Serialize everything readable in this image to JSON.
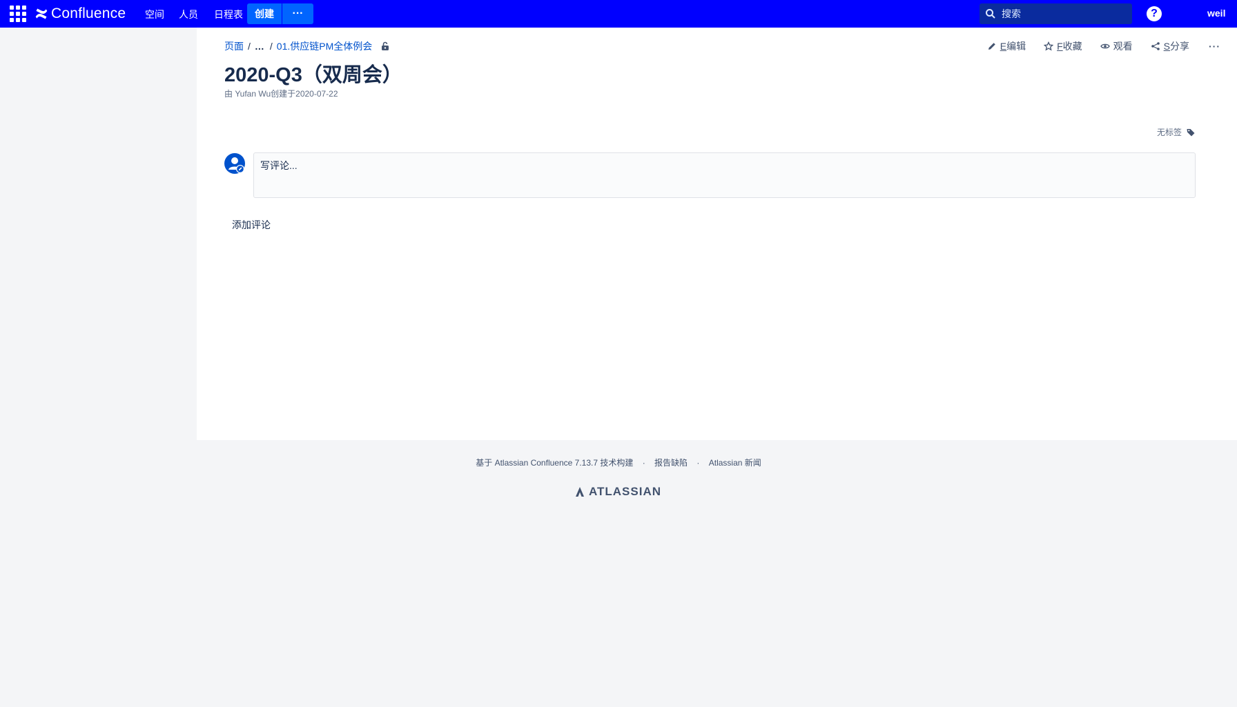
{
  "header": {
    "logo_text": "Confluence",
    "nav": [
      "空间",
      "人员",
      "日程表"
    ],
    "create_label": "创建",
    "more_label": "···",
    "search_placeholder": "搜索",
    "help_label": "?",
    "user": "weil"
  },
  "breadcrumb": {
    "root": "页面",
    "ellipsis": "…",
    "parent": "01.供应链PM全体例会"
  },
  "page": {
    "title": "2020-Q3（双周会）",
    "byline": "由 Yufan Wu创建于2020-07-22"
  },
  "actions": {
    "edit_key": "E",
    "edit_label": "编辑",
    "save_key": "F",
    "save_label": "收藏",
    "watch_label": "观看",
    "share_key": "S",
    "share_label": "分享",
    "more_label": "···"
  },
  "labels": {
    "text": "无标签"
  },
  "comments": {
    "placeholder": "写评论...",
    "add_label": "添加评论"
  },
  "footer": {
    "built_with": "基于 Atlassian Confluence 7.13.7 技术构建",
    "report_bug": "报告缺陷",
    "news": "Atlassian 新闻",
    "brand": "ATLASSIAN"
  },
  "colors": {
    "topbar": "#0000ff",
    "create_button": "#0065ff",
    "link": "#0052cc"
  }
}
